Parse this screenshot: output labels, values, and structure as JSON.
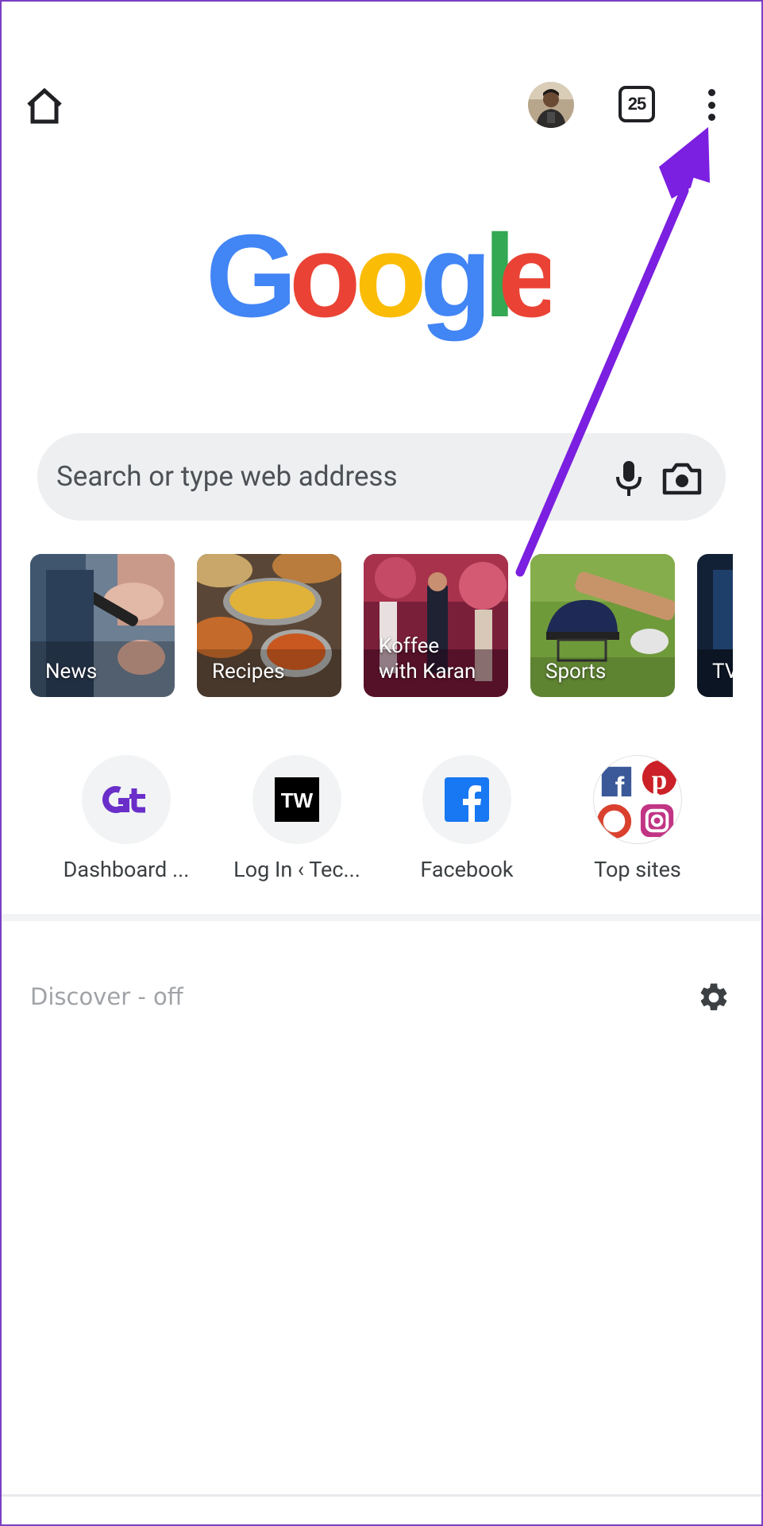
{
  "header": {
    "home_icon": "home-icon",
    "avatar_icon": "profile-avatar",
    "tab_count": "25",
    "menu_icon": "more-vert-icon"
  },
  "logo": {
    "letters": [
      "G",
      "o",
      "o",
      "g",
      "l",
      "e"
    ],
    "colors": [
      "#4285F4",
      "#EA4335",
      "#FBBC05",
      "#4285F4",
      "#34A853",
      "#EA4335"
    ]
  },
  "search": {
    "placeholder": "Search or type web address",
    "mic_icon": "mic-icon",
    "camera_icon": "camera-icon"
  },
  "topics": [
    {
      "label": "News"
    },
    {
      "label": "Recipes"
    },
    {
      "label": "Koffee\nwith Karan"
    },
    {
      "label": "Sports"
    },
    {
      "label": "TV"
    }
  ],
  "shortcuts": [
    {
      "label": "Dashboard ...",
      "icon": "gt-logo-icon"
    },
    {
      "label": "Log In ‹ Tec...",
      "icon": "tw-logo-icon"
    },
    {
      "label": "Facebook",
      "icon": "facebook-icon"
    },
    {
      "label": "Top sites",
      "icon": "top-sites-icon"
    }
  ],
  "discover": {
    "label": "Discover - off",
    "settings_icon": "gear-icon"
  },
  "annotation": {
    "arrow_color": "#7b1fe0"
  }
}
